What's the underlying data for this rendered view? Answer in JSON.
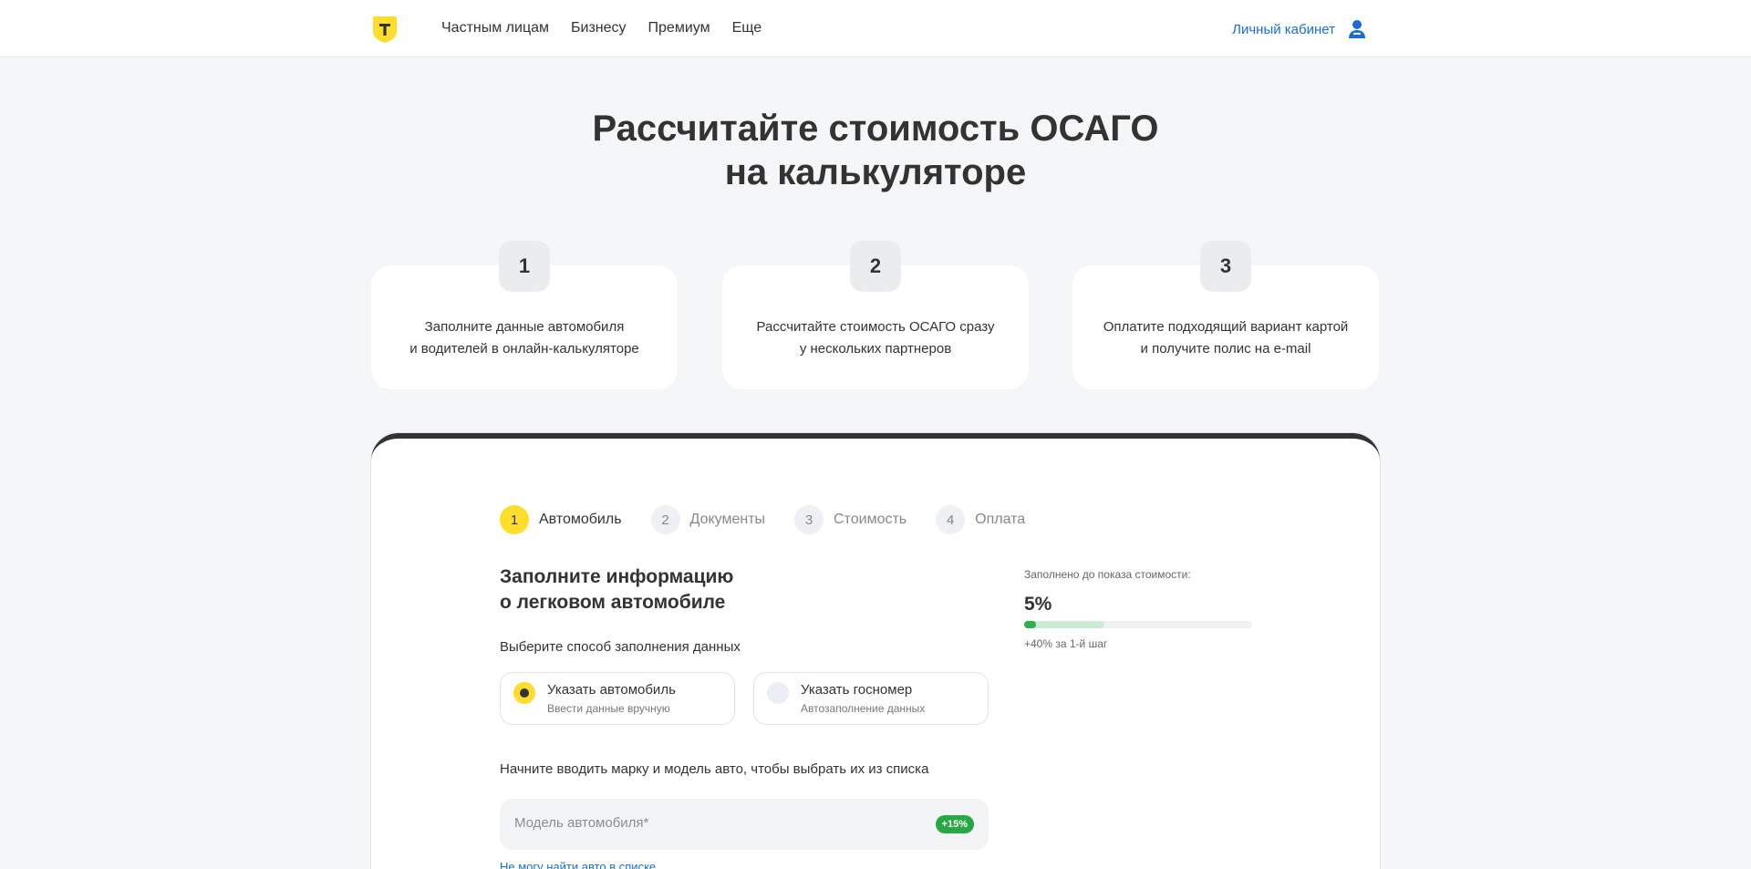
{
  "header": {
    "nav": [
      "Частным лицам",
      "Бизнесу",
      "Премиум",
      "Еще"
    ],
    "account_label": "Личный кабинет"
  },
  "hero": {
    "title_line1": "Рассчитайте стоимость ОСАГО",
    "title_line2": "на калькуляторе"
  },
  "steps": [
    {
      "number": "1",
      "line1": "Заполните данные автомобиля",
      "line2": "и водителей в онлайн-калькуляторе"
    },
    {
      "number": "2",
      "line1": "Рассчитайте стоимость ОСАГО сразу",
      "line2": "у нескольких партнеров"
    },
    {
      "number": "3",
      "line1": "Оплатите подходящий вариант картой",
      "line2": "и получите полис на e-mail"
    }
  ],
  "stepper": [
    {
      "number": "1",
      "label": "Автомобиль",
      "active": true
    },
    {
      "number": "2",
      "label": "Документы",
      "active": false
    },
    {
      "number": "3",
      "label": "Стоимость",
      "active": false
    },
    {
      "number": "4",
      "label": "Оплата",
      "active": false
    }
  ],
  "form": {
    "title_line1": "Заполните информацию",
    "title_line2": "о легковом автомобиле",
    "method_label": "Выберите способ заполнения данных",
    "options": [
      {
        "title": "Указать автомобиль",
        "subtitle": "Ввести данные вручную",
        "selected": true
      },
      {
        "title": "Указать госномер",
        "subtitle": "Автозаполнение данных",
        "selected": false
      }
    ],
    "hint": "Начните вводить марку и модель авто, чтобы выбрать их из списка",
    "model_placeholder": "Модель автомобиля*",
    "model_bonus": "+15%",
    "cant_find": "Не могу найти авто в списке"
  },
  "progress": {
    "label": "Заполнено до показа стоимости:",
    "percent_text": "5%",
    "value": 0.05,
    "potential": 0.35,
    "note": "+40% за 1-й шаг"
  },
  "colors": {
    "brand_yellow": "#ffdd2d",
    "link_blue": "#1a6dd5",
    "progress_green": "#27b24a"
  }
}
